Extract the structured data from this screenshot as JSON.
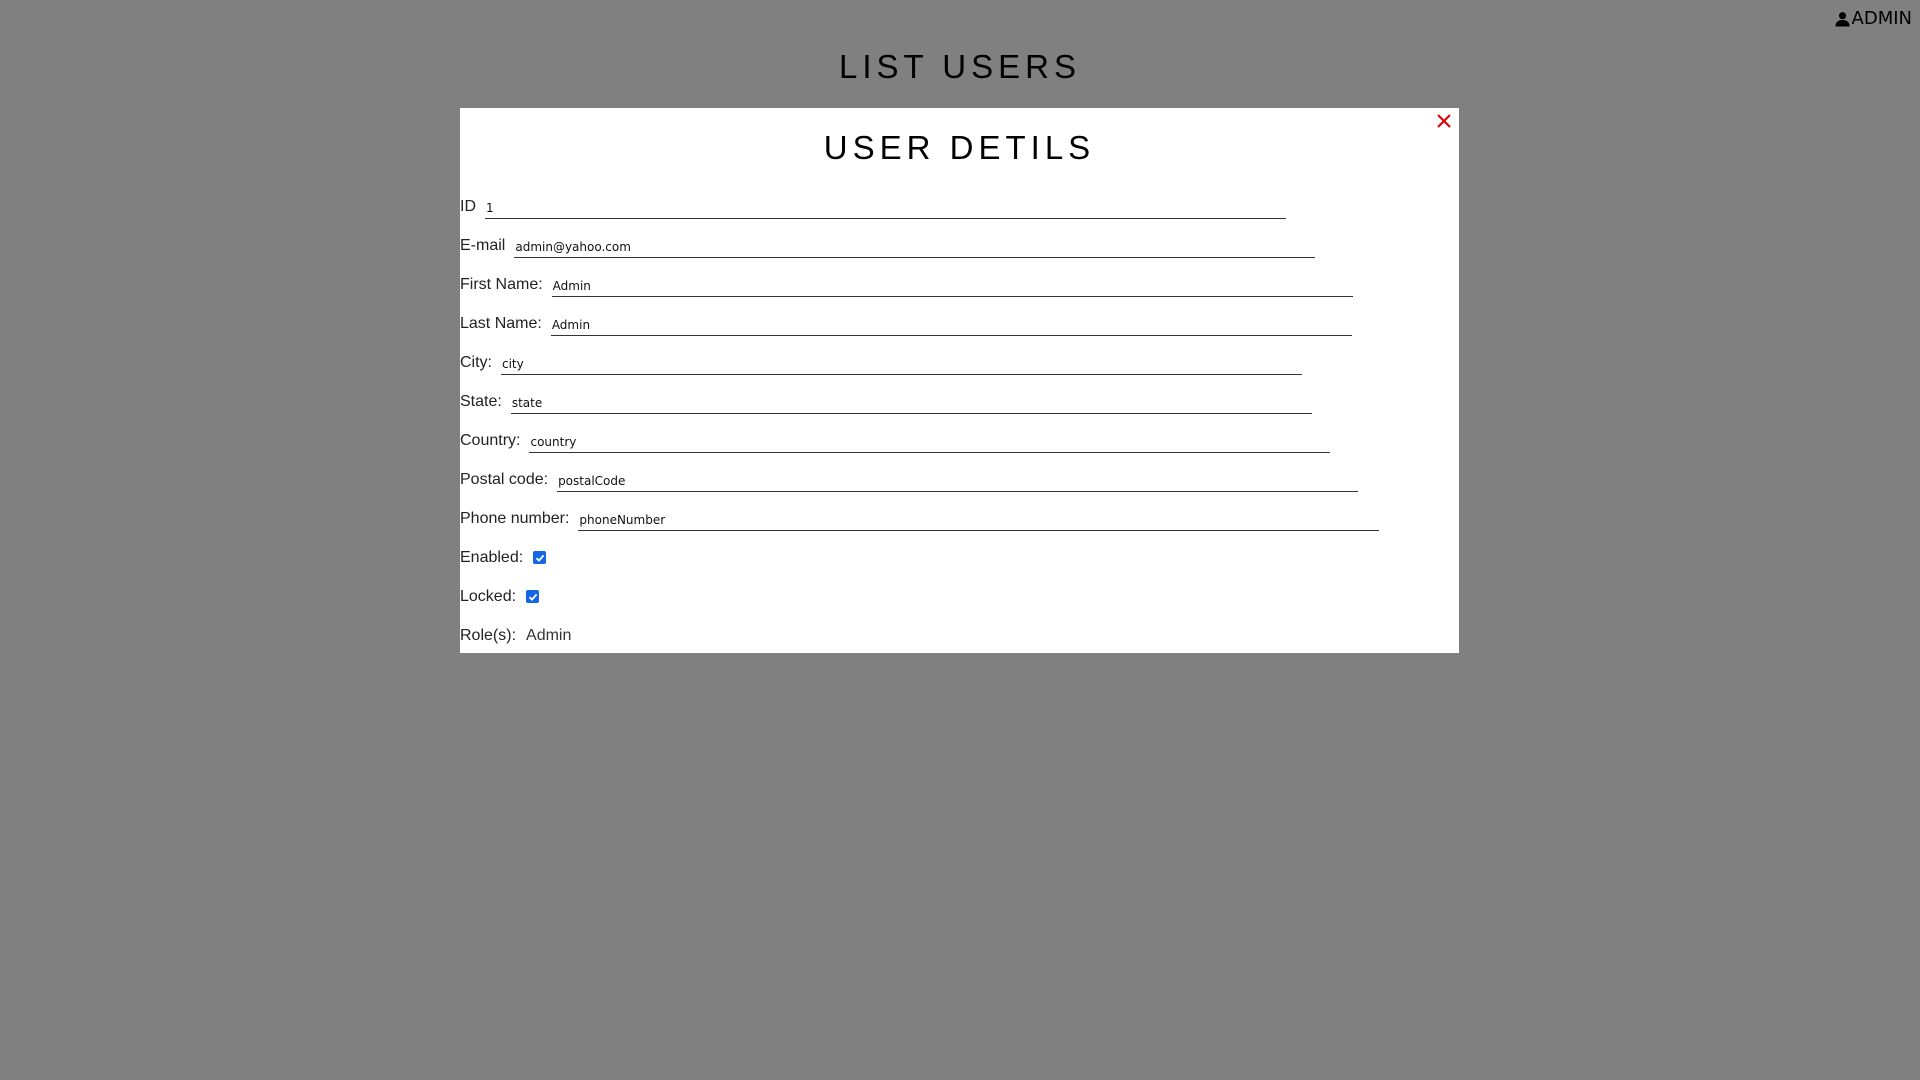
{
  "header": {
    "user_name": "ADMIN",
    "user_icon": "user-icon"
  },
  "page": {
    "title": "LIST USERS"
  },
  "modal": {
    "title": "USER DETILS",
    "close_label": "X",
    "close_color": "#e00000",
    "fields": [
      {
        "label": "ID",
        "value": "1"
      },
      {
        "label": "E-mail",
        "value": "admin@yahoo.com"
      },
      {
        "label": "First Name:",
        "value": "Admin"
      },
      {
        "label": "Last Name:",
        "value": "Admin"
      },
      {
        "label": "City:",
        "value": "city"
      },
      {
        "label": "State:",
        "value": "state"
      },
      {
        "label": "Country:",
        "value": "country"
      },
      {
        "label": "Postal code:",
        "value": "postalCode"
      },
      {
        "label": "Phone number:",
        "value": "phoneNumber"
      }
    ],
    "enabled": {
      "label": "Enabled:",
      "checked": true
    },
    "locked": {
      "label": "Locked:",
      "checked": true
    },
    "roles": {
      "label": "Role(s):",
      "value": "Admin"
    }
  },
  "colors": {
    "backdrop": "#808080",
    "checkbox": "#1565e6",
    "close": "#e00000"
  }
}
